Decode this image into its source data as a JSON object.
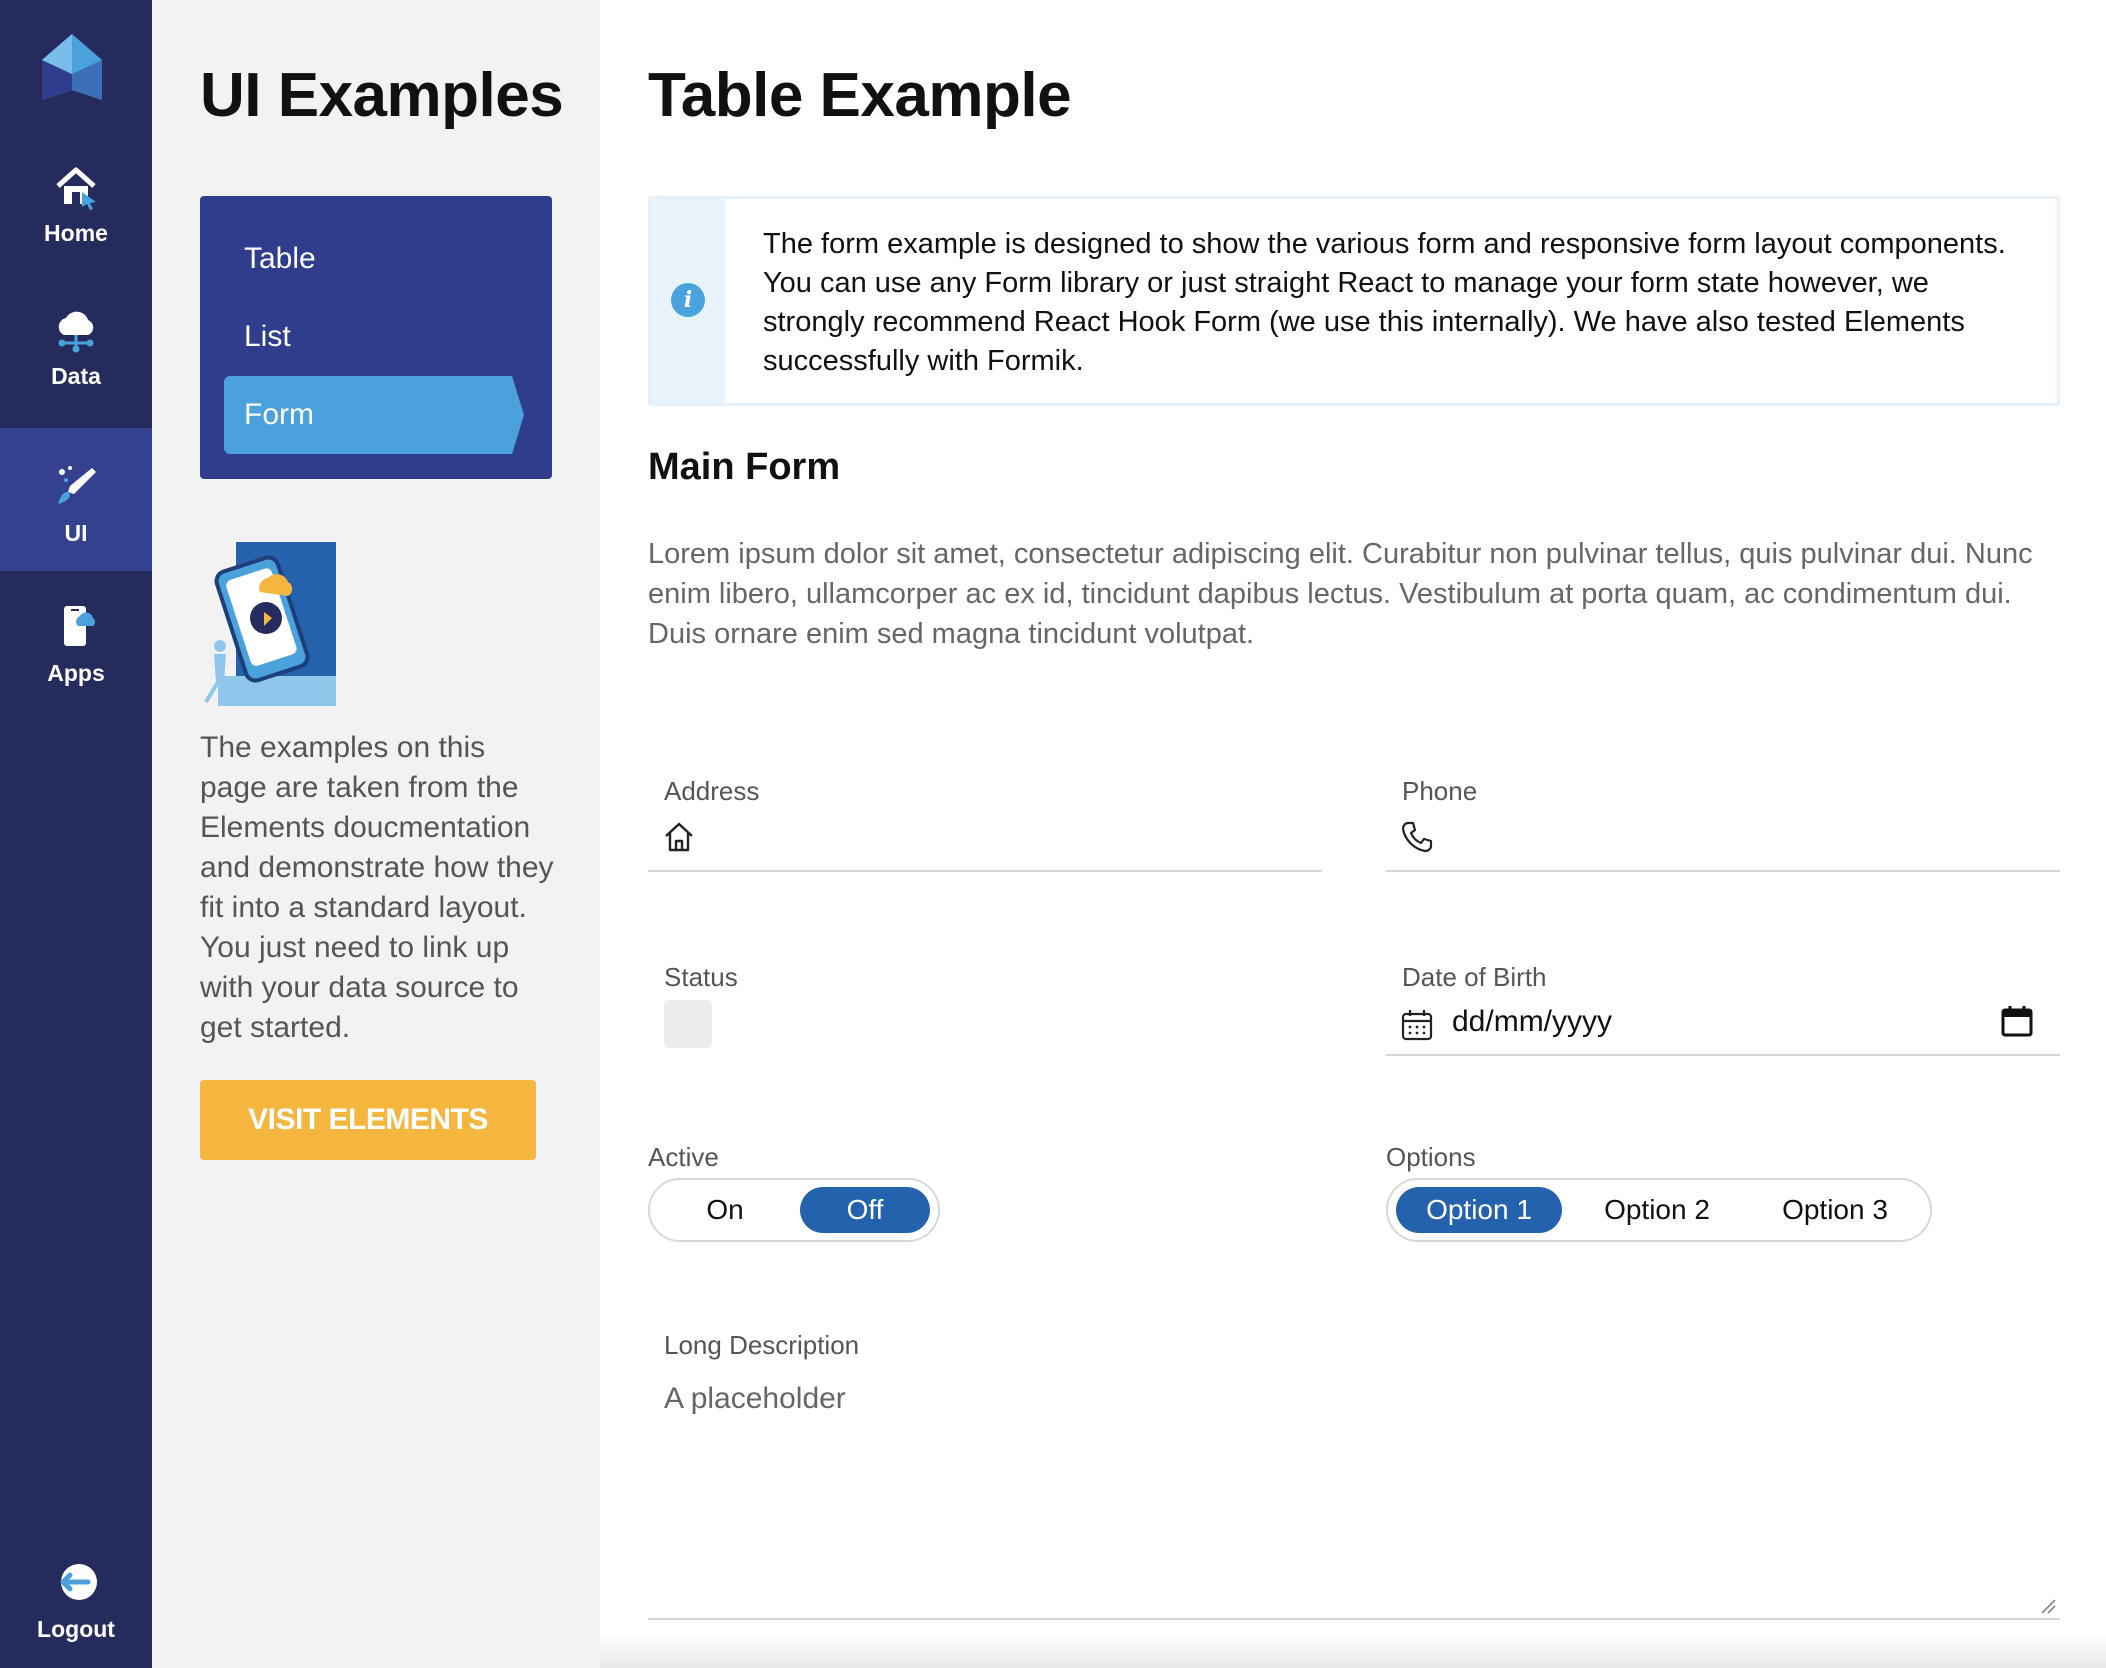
{
  "rail": {
    "items": [
      {
        "label": "Home",
        "icon": "home-icon"
      },
      {
        "label": "Data",
        "icon": "cloud-data-icon"
      },
      {
        "label": "UI",
        "icon": "ui-brush-icon"
      },
      {
        "label": "Apps",
        "icon": "apps-phone-icon"
      }
    ],
    "active": "UI",
    "logout_label": "Logout"
  },
  "panel": {
    "title": "UI Examples",
    "subnav": [
      "Table",
      "List",
      "Form"
    ],
    "active": "Form",
    "description": "The examples on this page are taken from the Elements doucmentation and demonstrate how they fit into a standard layout. You just need to link up with your data source to get started.",
    "visit_button": "VISIT ELEMENTS"
  },
  "main": {
    "title": "Table Example",
    "info_text": "The form example is designed to show the various form and responsive form layout components. You can use any Form library or just straight React to manage your form state however, we strongly recommend React Hook Form (we use this internally). We have also tested Elements successfully with Formik.",
    "section_title": "Main Form",
    "lorem": "Lorem ipsum dolor sit amet, consectetur adipiscing elit. Curabitur non pulvinar tellus, quis pulvinar dui. Nunc enim libero, ullamcorper ac ex id, tincidunt dapibus lectus. Vestibulum at porta quam, ac condimentum dui. Duis ornare enim sed magna tincidunt volutpat.",
    "form": {
      "address_label": "Address",
      "phone_label": "Phone",
      "status_label": "Status",
      "dob_label": "Date of Birth",
      "dob_value": "dd/mm/yyyy",
      "active_label": "Active",
      "active_options": [
        "On",
        "Off"
      ],
      "active_selected": "Off",
      "options_label": "Options",
      "options": [
        "Option 1",
        "Option 2",
        "Option 3"
      ],
      "options_selected": "Option 1",
      "long_desc_label": "Long Description",
      "long_desc_placeholder": "A placeholder"
    }
  },
  "colors": {
    "rail_bg": "#262b5d",
    "rail_active": "#34418f",
    "subnav_bg": "#2f3d8c",
    "subnav_active": "#4ba1dc",
    "accent_button": "#f4b63f",
    "toggle_selected": "#2562ad"
  }
}
